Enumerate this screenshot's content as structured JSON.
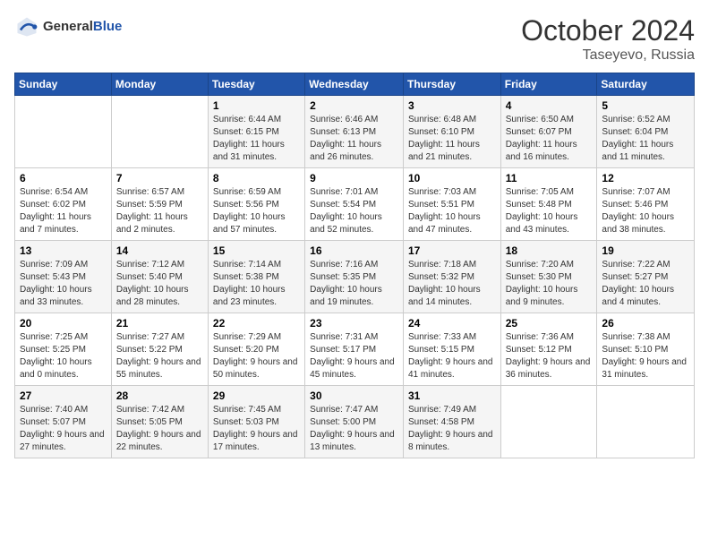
{
  "logo": {
    "text_general": "General",
    "text_blue": "Blue"
  },
  "title": {
    "month_year": "October 2024",
    "location": "Taseyevo, Russia"
  },
  "weekdays": [
    "Sunday",
    "Monday",
    "Tuesday",
    "Wednesday",
    "Thursday",
    "Friday",
    "Saturday"
  ],
  "weeks": [
    [
      {
        "day": "",
        "info": ""
      },
      {
        "day": "",
        "info": ""
      },
      {
        "day": "1",
        "info": "Sunrise: 6:44 AM\nSunset: 6:15 PM\nDaylight: 11 hours and 31 minutes."
      },
      {
        "day": "2",
        "info": "Sunrise: 6:46 AM\nSunset: 6:13 PM\nDaylight: 11 hours and 26 minutes."
      },
      {
        "day": "3",
        "info": "Sunrise: 6:48 AM\nSunset: 6:10 PM\nDaylight: 11 hours and 21 minutes."
      },
      {
        "day": "4",
        "info": "Sunrise: 6:50 AM\nSunset: 6:07 PM\nDaylight: 11 hours and 16 minutes."
      },
      {
        "day": "5",
        "info": "Sunrise: 6:52 AM\nSunset: 6:04 PM\nDaylight: 11 hours and 11 minutes."
      }
    ],
    [
      {
        "day": "6",
        "info": "Sunrise: 6:54 AM\nSunset: 6:02 PM\nDaylight: 11 hours and 7 minutes."
      },
      {
        "day": "7",
        "info": "Sunrise: 6:57 AM\nSunset: 5:59 PM\nDaylight: 11 hours and 2 minutes."
      },
      {
        "day": "8",
        "info": "Sunrise: 6:59 AM\nSunset: 5:56 PM\nDaylight: 10 hours and 57 minutes."
      },
      {
        "day": "9",
        "info": "Sunrise: 7:01 AM\nSunset: 5:54 PM\nDaylight: 10 hours and 52 minutes."
      },
      {
        "day": "10",
        "info": "Sunrise: 7:03 AM\nSunset: 5:51 PM\nDaylight: 10 hours and 47 minutes."
      },
      {
        "day": "11",
        "info": "Sunrise: 7:05 AM\nSunset: 5:48 PM\nDaylight: 10 hours and 43 minutes."
      },
      {
        "day": "12",
        "info": "Sunrise: 7:07 AM\nSunset: 5:46 PM\nDaylight: 10 hours and 38 minutes."
      }
    ],
    [
      {
        "day": "13",
        "info": "Sunrise: 7:09 AM\nSunset: 5:43 PM\nDaylight: 10 hours and 33 minutes."
      },
      {
        "day": "14",
        "info": "Sunrise: 7:12 AM\nSunset: 5:40 PM\nDaylight: 10 hours and 28 minutes."
      },
      {
        "day": "15",
        "info": "Sunrise: 7:14 AM\nSunset: 5:38 PM\nDaylight: 10 hours and 23 minutes."
      },
      {
        "day": "16",
        "info": "Sunrise: 7:16 AM\nSunset: 5:35 PM\nDaylight: 10 hours and 19 minutes."
      },
      {
        "day": "17",
        "info": "Sunrise: 7:18 AM\nSunset: 5:32 PM\nDaylight: 10 hours and 14 minutes."
      },
      {
        "day": "18",
        "info": "Sunrise: 7:20 AM\nSunset: 5:30 PM\nDaylight: 10 hours and 9 minutes."
      },
      {
        "day": "19",
        "info": "Sunrise: 7:22 AM\nSunset: 5:27 PM\nDaylight: 10 hours and 4 minutes."
      }
    ],
    [
      {
        "day": "20",
        "info": "Sunrise: 7:25 AM\nSunset: 5:25 PM\nDaylight: 10 hours and 0 minutes."
      },
      {
        "day": "21",
        "info": "Sunrise: 7:27 AM\nSunset: 5:22 PM\nDaylight: 9 hours and 55 minutes."
      },
      {
        "day": "22",
        "info": "Sunrise: 7:29 AM\nSunset: 5:20 PM\nDaylight: 9 hours and 50 minutes."
      },
      {
        "day": "23",
        "info": "Sunrise: 7:31 AM\nSunset: 5:17 PM\nDaylight: 9 hours and 45 minutes."
      },
      {
        "day": "24",
        "info": "Sunrise: 7:33 AM\nSunset: 5:15 PM\nDaylight: 9 hours and 41 minutes."
      },
      {
        "day": "25",
        "info": "Sunrise: 7:36 AM\nSunset: 5:12 PM\nDaylight: 9 hours and 36 minutes."
      },
      {
        "day": "26",
        "info": "Sunrise: 7:38 AM\nSunset: 5:10 PM\nDaylight: 9 hours and 31 minutes."
      }
    ],
    [
      {
        "day": "27",
        "info": "Sunrise: 7:40 AM\nSunset: 5:07 PM\nDaylight: 9 hours and 27 minutes."
      },
      {
        "day": "28",
        "info": "Sunrise: 7:42 AM\nSunset: 5:05 PM\nDaylight: 9 hours and 22 minutes."
      },
      {
        "day": "29",
        "info": "Sunrise: 7:45 AM\nSunset: 5:03 PM\nDaylight: 9 hours and 17 minutes."
      },
      {
        "day": "30",
        "info": "Sunrise: 7:47 AM\nSunset: 5:00 PM\nDaylight: 9 hours and 13 minutes."
      },
      {
        "day": "31",
        "info": "Sunrise: 7:49 AM\nSunset: 4:58 PM\nDaylight: 9 hours and 8 minutes."
      },
      {
        "day": "",
        "info": ""
      },
      {
        "day": "",
        "info": ""
      }
    ]
  ]
}
